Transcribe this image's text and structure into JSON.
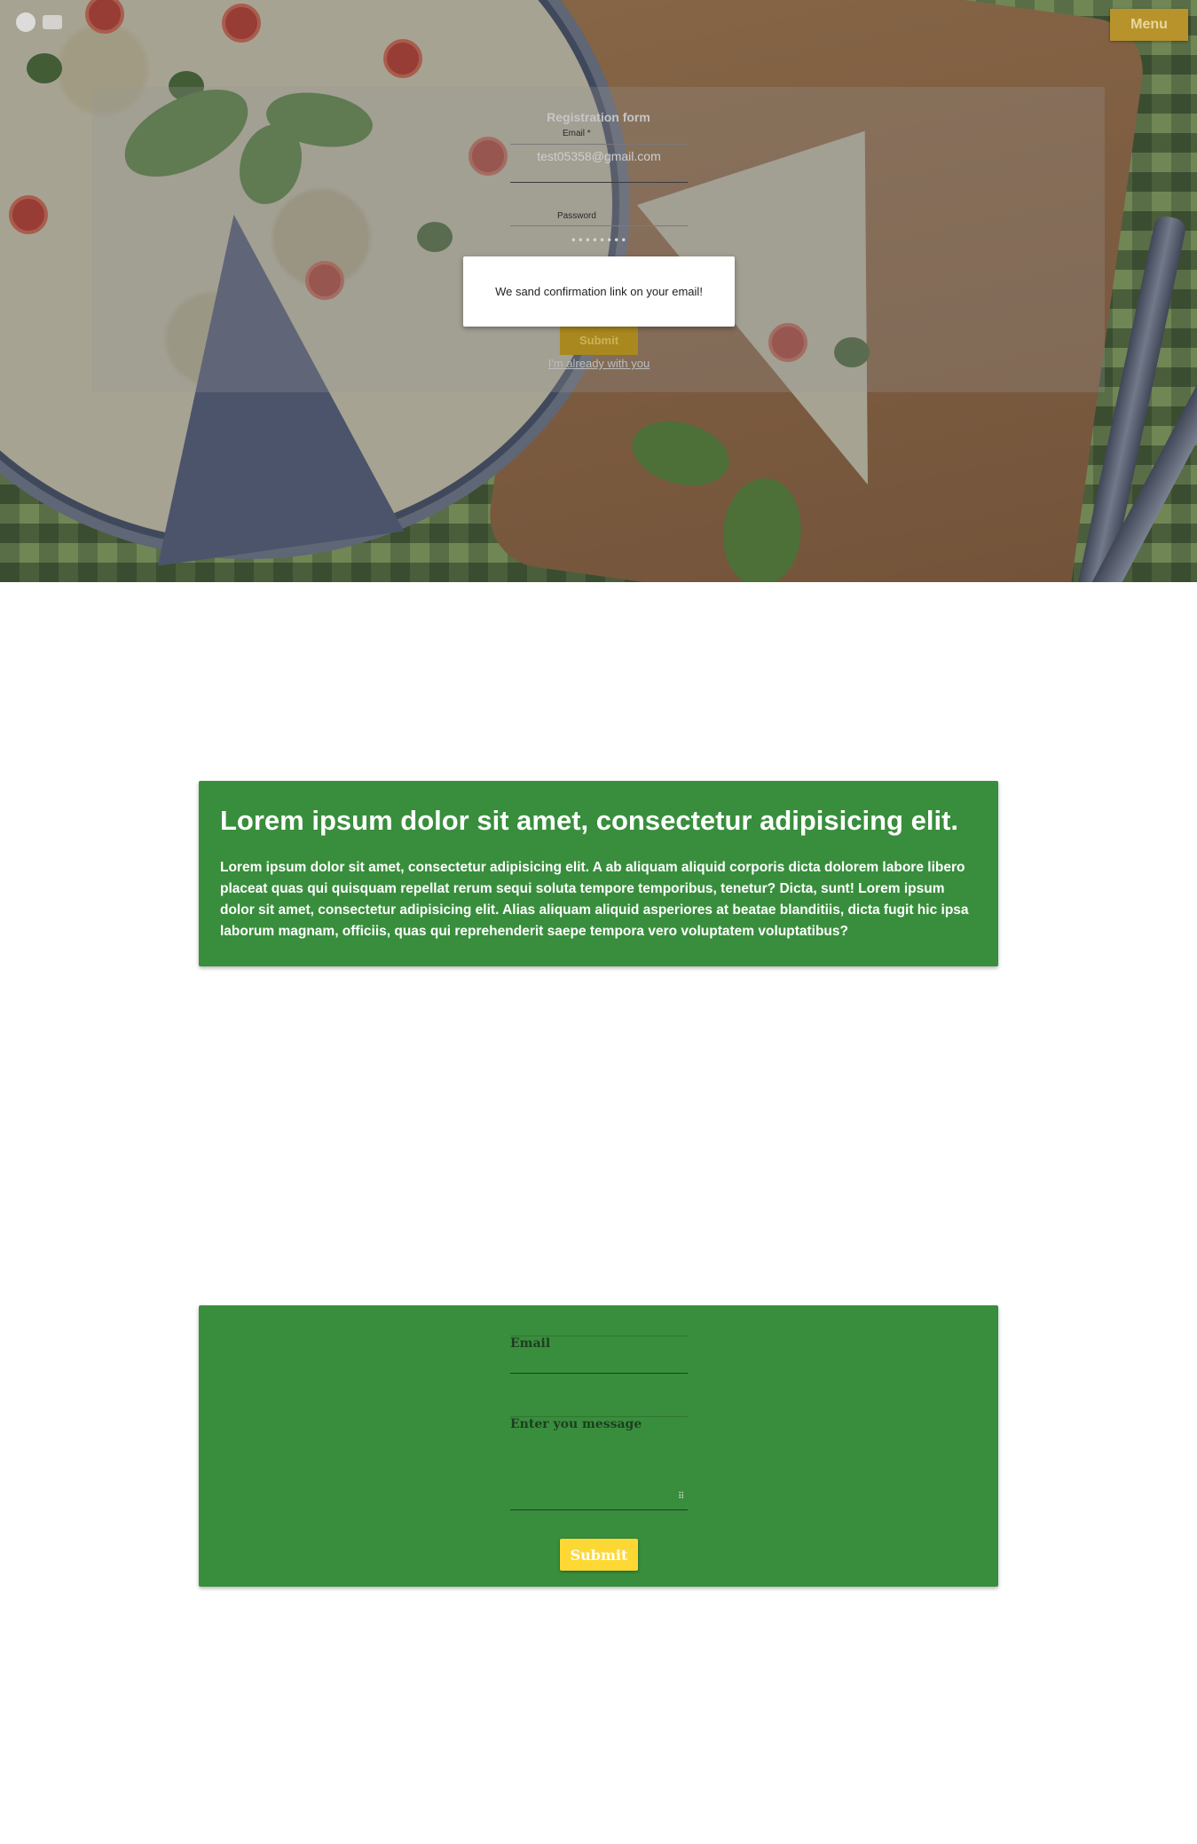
{
  "header": {
    "menu_label": "Menu"
  },
  "registration": {
    "title": "Registration form",
    "email_label": "Email *",
    "email_value": "test05358@gmail.com",
    "password_label": "Password",
    "password_value": "••••••••",
    "submit_label": "Submit",
    "already_link": "I'm already with you"
  },
  "toast": {
    "message": "We sand confirmation link on your email!"
  },
  "info_card": {
    "heading": "Lorem ipsum dolor sit amet, consectetur adipisicing elit.",
    "body": "Lorem ipsum dolor sit amet, consectetur adipisicing elit. A ab aliquam aliquid corporis dicta dolorem labore libero placeat quas qui quisquam repellat rerum sequi soluta tempore temporibus, tenetur? Dicta, sunt! Lorem ipsum dolor sit amet, consectetur adipisicing elit. Alias aliquam aliquid asperiores at beatae blanditiis, dicta fugit hic ipsa laborum magnam, officiis, quas qui reprehenderit saepe tempora vero voluptatem voluptatibus?"
  },
  "contact": {
    "email_label": "Email",
    "message_label": "Enter you message",
    "submit_label": "Submit"
  },
  "colors": {
    "card_green": "#388e3c",
    "accent_yellow": "#fdd835",
    "menu_gold": "#b8932c"
  },
  "icons": {
    "logo": "logo-icon",
    "resize": "resize-handle-icon"
  }
}
